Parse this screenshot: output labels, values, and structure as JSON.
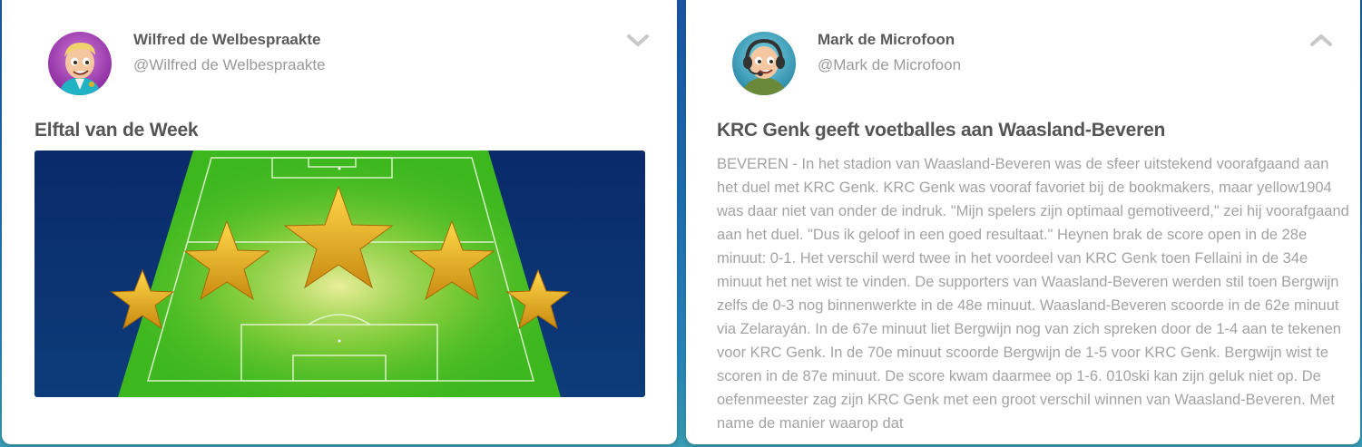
{
  "posts": [
    {
      "author_name": "Wilfred de Welbespraakte",
      "author_handle": "@Wilfred de Welbespraakte",
      "toggle_icon": "chevron-down-icon",
      "title": "Elftal van de Week",
      "image_description_icon": "five-stars-football-pitch"
    },
    {
      "author_name": "Mark de Microfoon",
      "author_handle": "@Mark de Microfoon",
      "toggle_icon": "chevron-up-icon",
      "title": "KRC Genk geeft voetballes aan Waasland-Beveren",
      "body": "BEVEREN - In het stadion van Waasland-Beveren was de sfeer uitstekend voorafgaand aan het duel met KRC Genk. KRC Genk was vooraf favoriet bij de bookmakers, maar yellow1904 was daar niet van onder de indruk. \"Mijn spelers zijn optimaal gemotiveerd,\" zei hij voorafgaand aan het duel. \"Dus ik geloof in een goed resultaat.\" Heynen brak de score open in de 28e minuut: 0-1. Het verschil werd twee in het voordeel van KRC Genk toen Fellaini in de 34e minuut het net wist te vinden. De supporters van Waasland-Beveren werden stil toen Bergwijn zelfs de 0-3 nog binnenwerkte in de 48e minuut. Waasland-Beveren scoorde in de 62e minuut via Zelarayán. In de 67e minuut liet Bergwijn nog van zich spreken door de 1-4 aan te tekenen voor KRC Genk. In de 70e minuut scoorde Bergwijn de 1-5 voor KRC Genk. Bergwijn wist te scoren in de 87e minuut. De score kwam daarmee op 1-6. 010ski kan zijn geluk niet op. De oefenmeester zag zijn KRC Genk met een groot verschil winnen van Waasland-Beveren. Met name de manier waarop dat"
    }
  ],
  "colors": {
    "title": "#555555",
    "handle": "#9a9a9a",
    "body": "#a3a3a3",
    "pitch": "#3cb81e"
  }
}
